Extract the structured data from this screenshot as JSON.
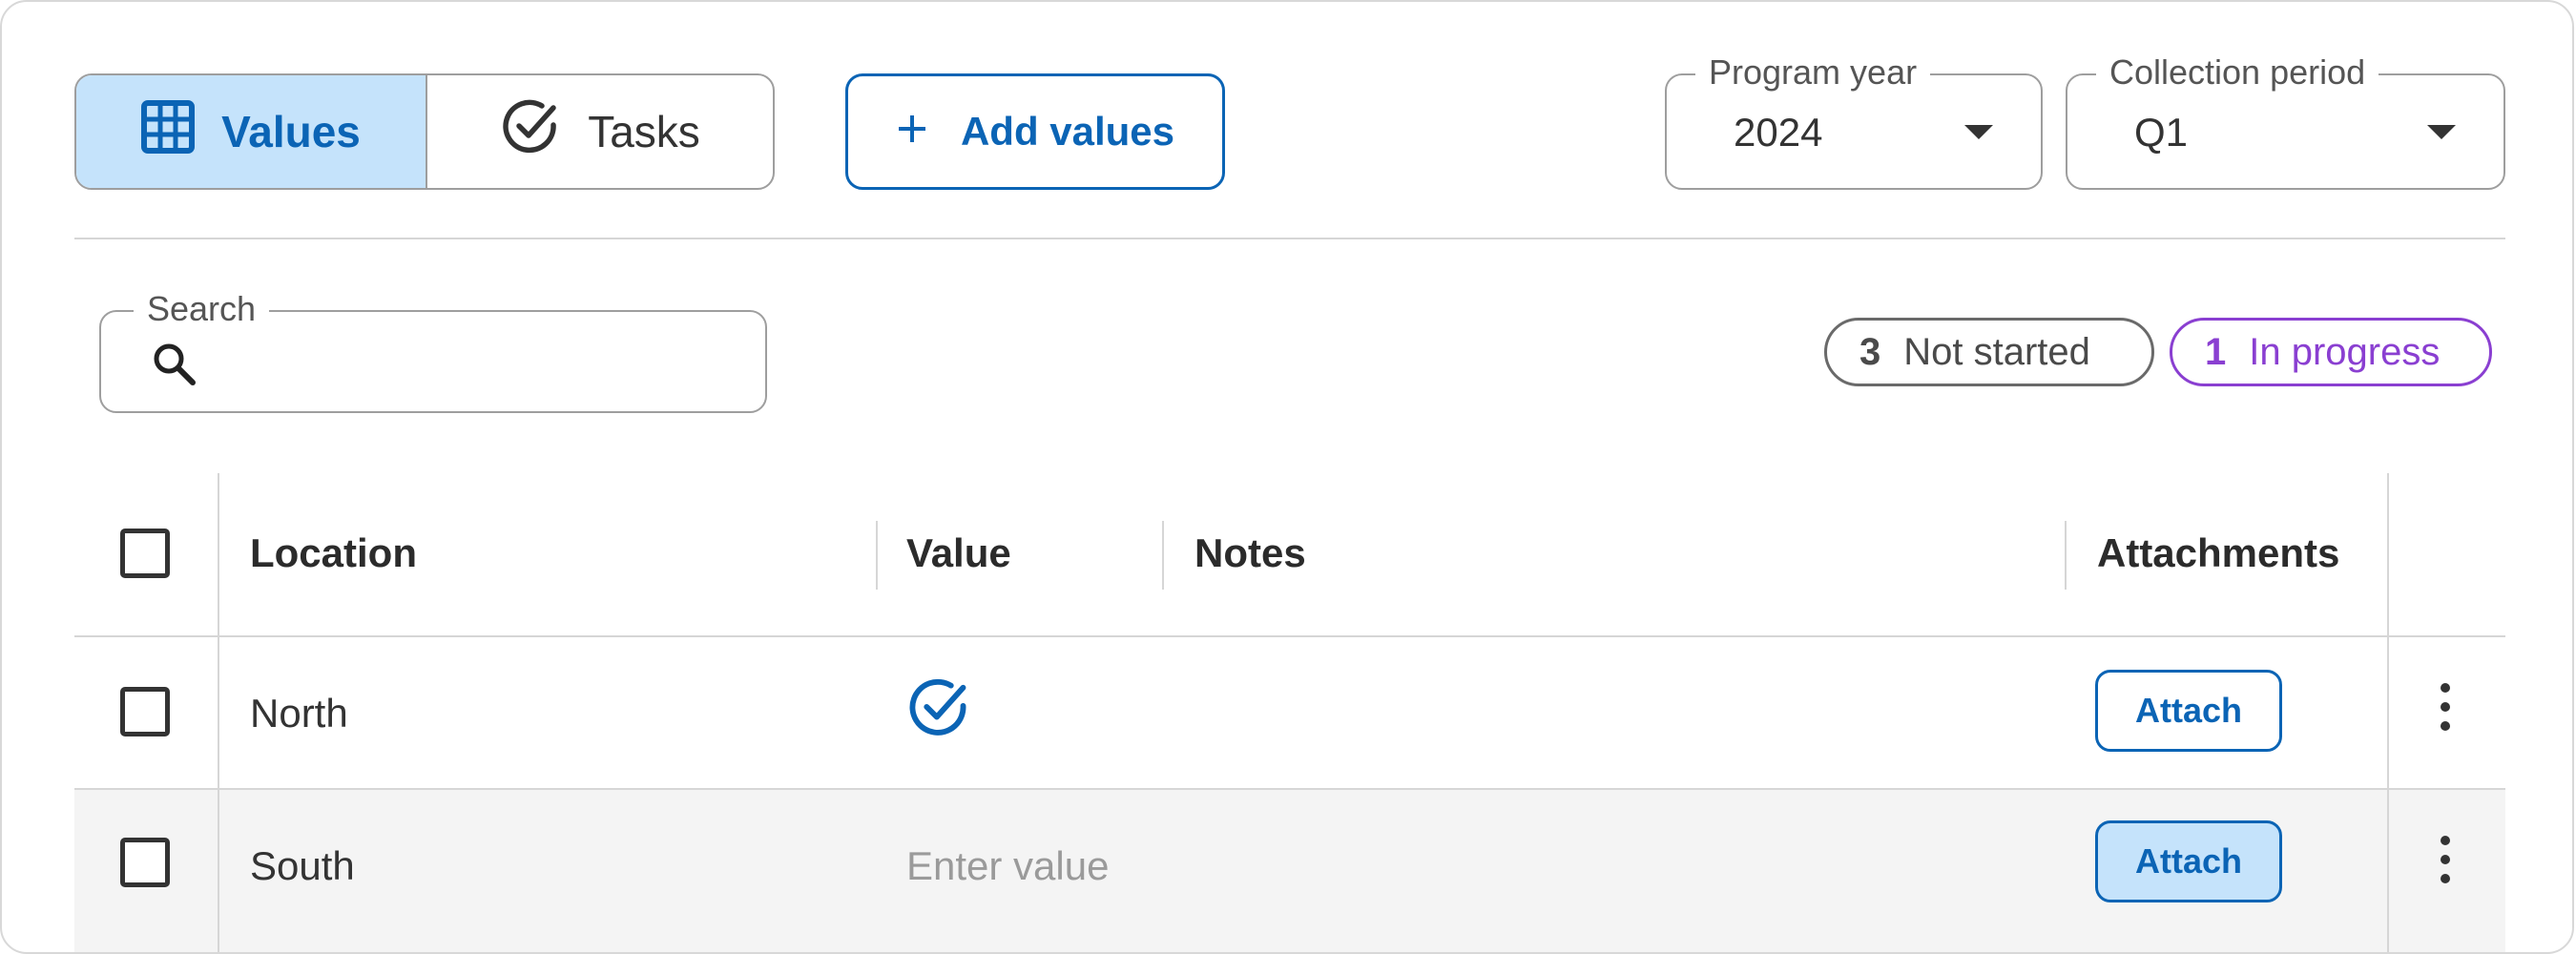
{
  "toggle": {
    "values_label": "Values",
    "tasks_label": "Tasks"
  },
  "add_values_label": "Add values",
  "program_year": {
    "label": "Program year",
    "value": "2024"
  },
  "collection_period": {
    "label": "Collection period",
    "value": "Q1"
  },
  "search": {
    "label": "Search",
    "placeholder": ""
  },
  "status_chips": {
    "not_started": {
      "count": "3",
      "label": "Not started"
    },
    "in_progress": {
      "count": "1",
      "label": "In progress"
    }
  },
  "table": {
    "headers": {
      "location": "Location",
      "value": "Value",
      "notes": "Notes",
      "attachments": "Attachments"
    },
    "rows": [
      {
        "location": "North",
        "value_state": "completed-check-icon",
        "notes": "",
        "attach_label": "Attach"
      },
      {
        "location": "South",
        "value_placeholder": "Enter value",
        "notes": "",
        "attach_label": "Attach"
      }
    ]
  },
  "colors": {
    "accent": "#0b64b5",
    "accent_light": "#c5e3fb",
    "in_progress": "#8a3fd1",
    "not_started": "#6a6a6a",
    "border": "#9e9e9e"
  }
}
